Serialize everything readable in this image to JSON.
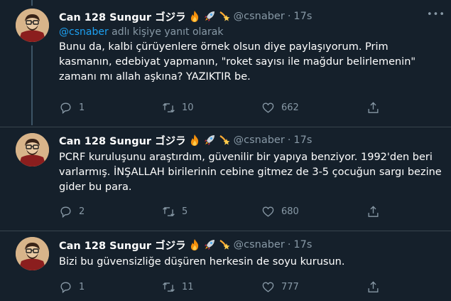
{
  "colors": {
    "background": "#15202b",
    "separator": "#38444d",
    "muted": "#8899a6",
    "link": "#1da1f2",
    "text": "#ffffff"
  },
  "tweets": [
    {
      "display_name": "Can 128 Sungur ゴジラ",
      "emojis": [
        "fire-icon",
        "rocket-icon",
        "dizzy-comet-icon"
      ],
      "handle": "@csnaber",
      "dot": "·",
      "time": "17s",
      "reply_to_mention": "@csnaber",
      "reply_to_suffix": " adlı kişiye yanıt olarak",
      "text": "Bunu da, kalbi çürüyenlere örnek olsun diye paylaşıyorum. Prim kasmanın, edebiyat yapmanın, \"roket sayısı ile mağdur belirlemenin\" zamanı mı allah aşkına? YAZIKTIR be.",
      "replies": "1",
      "retweets": "10",
      "likes": "662"
    },
    {
      "display_name": "Can 128 Sungur ゴジラ",
      "emojis": [
        "fire-icon",
        "rocket-icon",
        "dizzy-comet-icon"
      ],
      "handle": "@csnaber",
      "dot": "·",
      "time": "17s",
      "text": "PCRF kuruluşunu araştırdım, güvenilir bir yapıya benziyor. 1992'den beri varlarmış. İNŞALLAH birilerinin cebine gitmez de 3-5 çocuğun sargı bezine gider bu para.",
      "replies": "2",
      "retweets": "5",
      "likes": "680"
    },
    {
      "display_name": "Can 128 Sungur ゴジラ",
      "emojis": [
        "fire-icon",
        "rocket-icon",
        "dizzy-comet-icon"
      ],
      "handle": "@csnaber",
      "dot": "·",
      "time": "17s",
      "text": "Bizi bu güvensizliğe düşüren herkesin de soyu kurusun.",
      "replies": "1",
      "retweets": "11",
      "likes": "777"
    }
  ]
}
